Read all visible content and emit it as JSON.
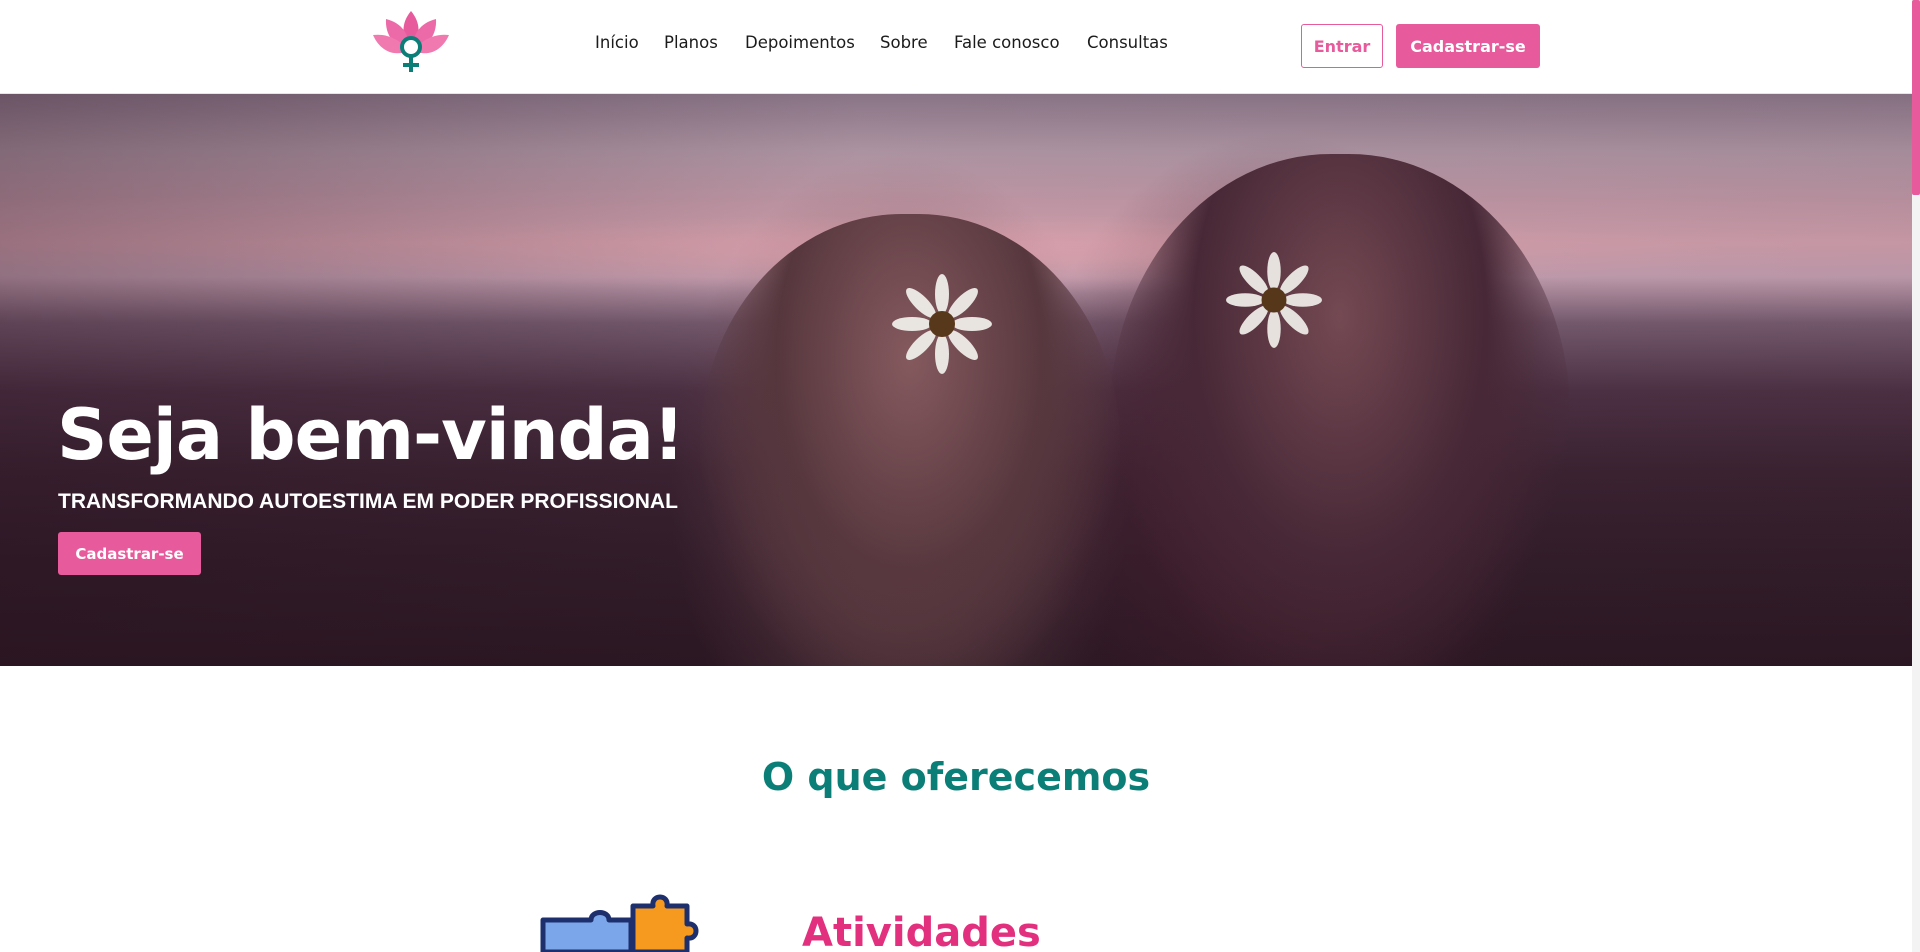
{
  "header": {
    "logo_icon": "lotus-female-symbol-icon",
    "nav": [
      {
        "label": "Início"
      },
      {
        "label": "Planos"
      },
      {
        "label": "Depoimentos"
      },
      {
        "label": "Sobre"
      },
      {
        "label": "Fale conosco"
      },
      {
        "label": "Consultas"
      }
    ],
    "login_label": "Entrar",
    "signup_label": "Cadastrar-se"
  },
  "hero": {
    "title": "Seja bem-vinda!",
    "subtitle": "TRANSFORMANDO AUTOESTIMA EM PODER PROFISSIONAL",
    "cta_label": "Cadastrar-se",
    "image_description_icon": "women-holding-daisies-photo"
  },
  "offerings": {
    "title": "O que oferecemos",
    "items": [
      {
        "icon": "puzzle-pieces-icon",
        "title": "Atividades"
      }
    ]
  },
  "colors": {
    "brand_pink": "#e75a9b",
    "brand_teal": "#0c7e78",
    "heading_pink": "#e2307f"
  }
}
